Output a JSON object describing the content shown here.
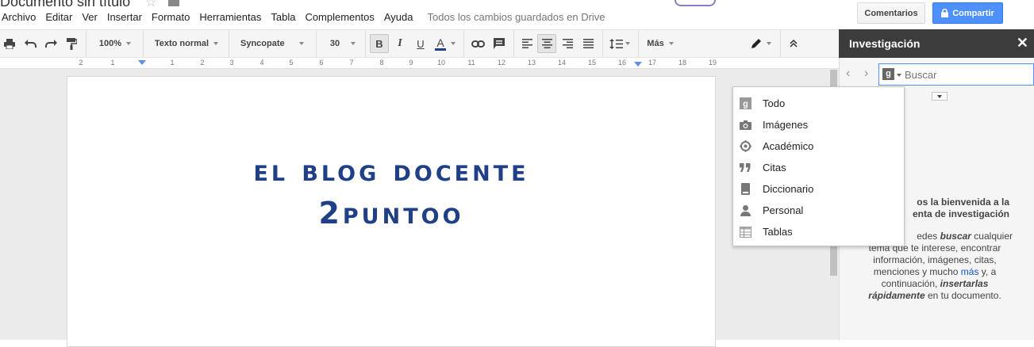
{
  "doc": {
    "title_fragment": "Documento sin título"
  },
  "menubar": {
    "items": [
      "Archivo",
      "Editar",
      "Ver",
      "Insertar",
      "Formato",
      "Herramientas",
      "Tabla",
      "Complementos",
      "Ayuda"
    ],
    "saved_status": "Todos los cambios guardados en Drive"
  },
  "header": {
    "comments_label": "Comentarios",
    "share_label": "Compartir"
  },
  "toolbar": {
    "zoom": "100%",
    "style": "Texto normal",
    "font": "Syncopate",
    "size": "30",
    "bold": "B",
    "italic": "I",
    "underline": "U",
    "text_color": "A",
    "more": "Más"
  },
  "ruler": {
    "ticks": [
      "2",
      "1",
      "1",
      "2",
      "3",
      "4",
      "5",
      "6",
      "7",
      "8",
      "9",
      "10",
      "11",
      "12",
      "13",
      "14",
      "15",
      "16",
      "17",
      "18",
      "19"
    ]
  },
  "document": {
    "line1": "EL BLOG DOCENTE",
    "line2": "2PUNTOO",
    "color": "#1f3f86"
  },
  "research_menu": {
    "items": [
      {
        "label": "Todo",
        "icon": "google-g-icon"
      },
      {
        "label": "Imágenes",
        "icon": "camera-icon"
      },
      {
        "label": "Académico",
        "icon": "scholar-icon"
      },
      {
        "label": "Citas",
        "icon": "quote-icon"
      },
      {
        "label": "Diccionario",
        "icon": "book-icon"
      },
      {
        "label": "Personal",
        "icon": "person-icon"
      },
      {
        "label": "Tablas",
        "icon": "table-icon"
      }
    ]
  },
  "panel": {
    "title": "Investigación",
    "search_placeholder": "Buscar",
    "welcome_line1": "os la bienvenida a la",
    "welcome_line2": "enta de investigación",
    "desc_line1_a": "edes ",
    "desc_line1_b": "buscar",
    "desc_line1_c": " cualquier",
    "desc_line2": "tema que te interese, encontrar",
    "desc_line3": "información, imágenes, citas,",
    "desc_line4_a": "menciones y mucho ",
    "desc_line4_link": "más",
    "desc_line4_b": " y, a",
    "desc_line5_a": "continuación, ",
    "desc_line5_b": "insertarlas",
    "desc_line6_a": "rápidamente",
    "desc_line6_b": " en tu documento."
  },
  "colors": {
    "accent": "#4d90fe",
    "panel_header": "#3c3c3c",
    "doc_text": "#1f3f86"
  }
}
